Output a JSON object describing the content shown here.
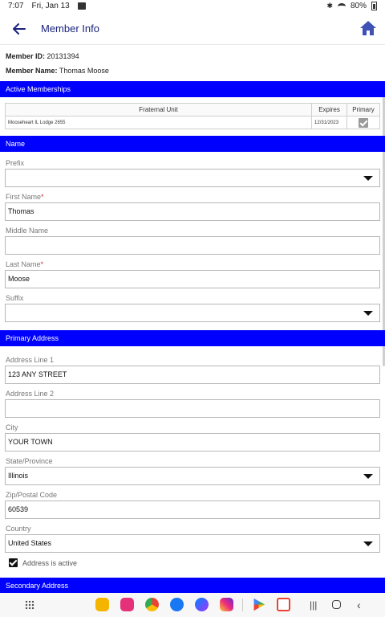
{
  "status_bar": {
    "time": "7:07",
    "date": "Fri, Jan 13",
    "battery": "80%"
  },
  "app_bar": {
    "title": "Member Info"
  },
  "member": {
    "id_label": "Member ID:",
    "id_value": "20131394",
    "name_label": "Member Name:",
    "name_value": "Thomas Moose"
  },
  "memberships": {
    "header": "Active Memberships",
    "columns": [
      "Fraternal Unit",
      "Expires",
      "Primary"
    ],
    "rows": [
      {
        "unit": "Mooseheart IL Lodge 2655",
        "expires": "12/31/2023",
        "primary": true
      }
    ]
  },
  "name_section": {
    "header": "Name",
    "prefix_label": "Prefix",
    "prefix_value": "",
    "first_label": "First Name",
    "first_value": "Thomas",
    "middle_label": "Middle Name",
    "middle_value": "",
    "last_label": "Last Name",
    "last_value": "Moose",
    "suffix_label": "Suffix",
    "suffix_value": "",
    "required_mark": "*"
  },
  "address_section": {
    "header": "Primary Address",
    "line1_label": "Address Line 1",
    "line1_value": "123 ANY STREET",
    "line2_label": "Address Line 2",
    "line2_value": "",
    "city_label": "City",
    "city_value": "YOUR TOWN",
    "state_label": "State/Province",
    "state_value": "Illinois",
    "zip_label": "Zip/Postal Code",
    "zip_value": "60539",
    "country_label": "Country",
    "country_value": "United States",
    "active_label": "Address is active",
    "active_checked": true
  },
  "secondary_section": {
    "header": "Secondary Address"
  },
  "colors": {
    "section_header": "#0000ff",
    "title": "#1a237e",
    "required": "#d32f2f"
  }
}
